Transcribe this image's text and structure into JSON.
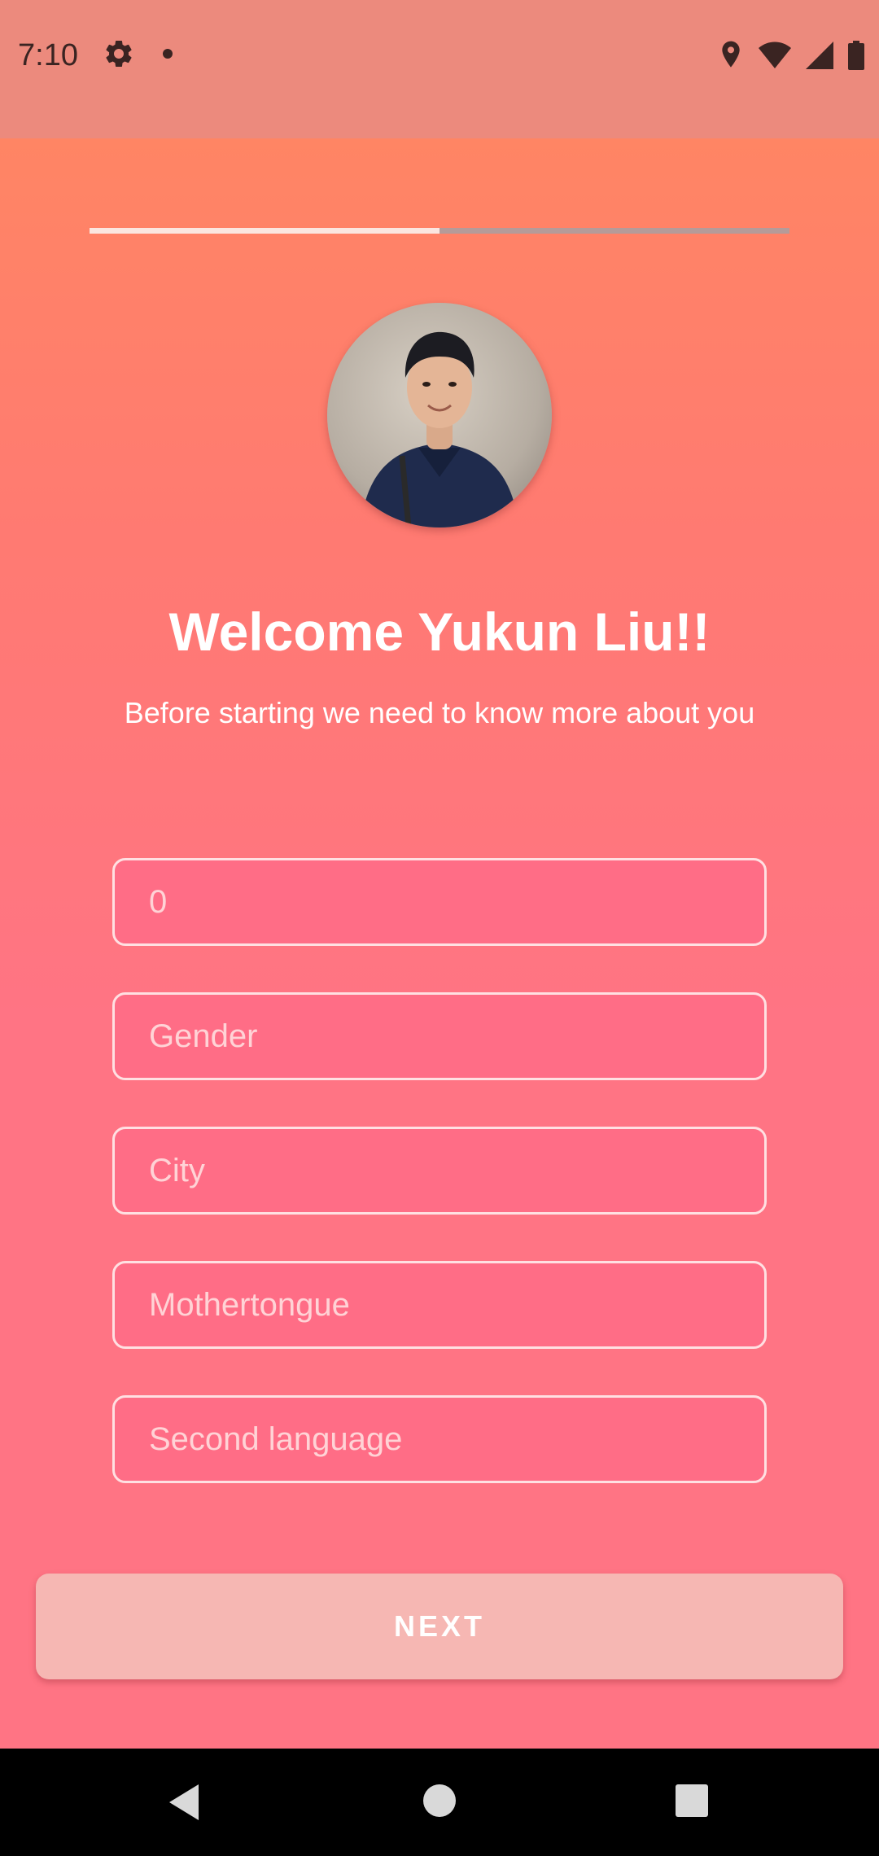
{
  "status_bar": {
    "time": "7:10",
    "icons": [
      "gear-icon",
      "notification-dot-icon",
      "location-icon",
      "wifi-icon",
      "cell-signal-icon",
      "battery-icon"
    ]
  },
  "onboarding": {
    "progress": 0.5,
    "welcome_title": "Welcome Yukun Liu!!",
    "subtitle": "Before starting we need to know more about you"
  },
  "form": {
    "age": {
      "value": "",
      "placeholder": "0"
    },
    "gender": {
      "value": "",
      "placeholder": "Gender"
    },
    "city": {
      "value": "",
      "placeholder": "City"
    },
    "mothertongue": {
      "value": "",
      "placeholder": "Mothertongue"
    },
    "second_language": {
      "value": "",
      "placeholder": "Second language"
    }
  },
  "next_button": {
    "label": "NEXT"
  },
  "colors": {
    "status_bar": "#ec8a7d",
    "gradient_top": "#ff8564",
    "gradient_bottom": "#ff7484",
    "field_border": "#ffe0e2",
    "button": "#f6b7b3",
    "text": "#ffffff"
  },
  "nav_bar": {
    "icons": [
      "back-icon",
      "home-icon",
      "recents-icon"
    ]
  }
}
